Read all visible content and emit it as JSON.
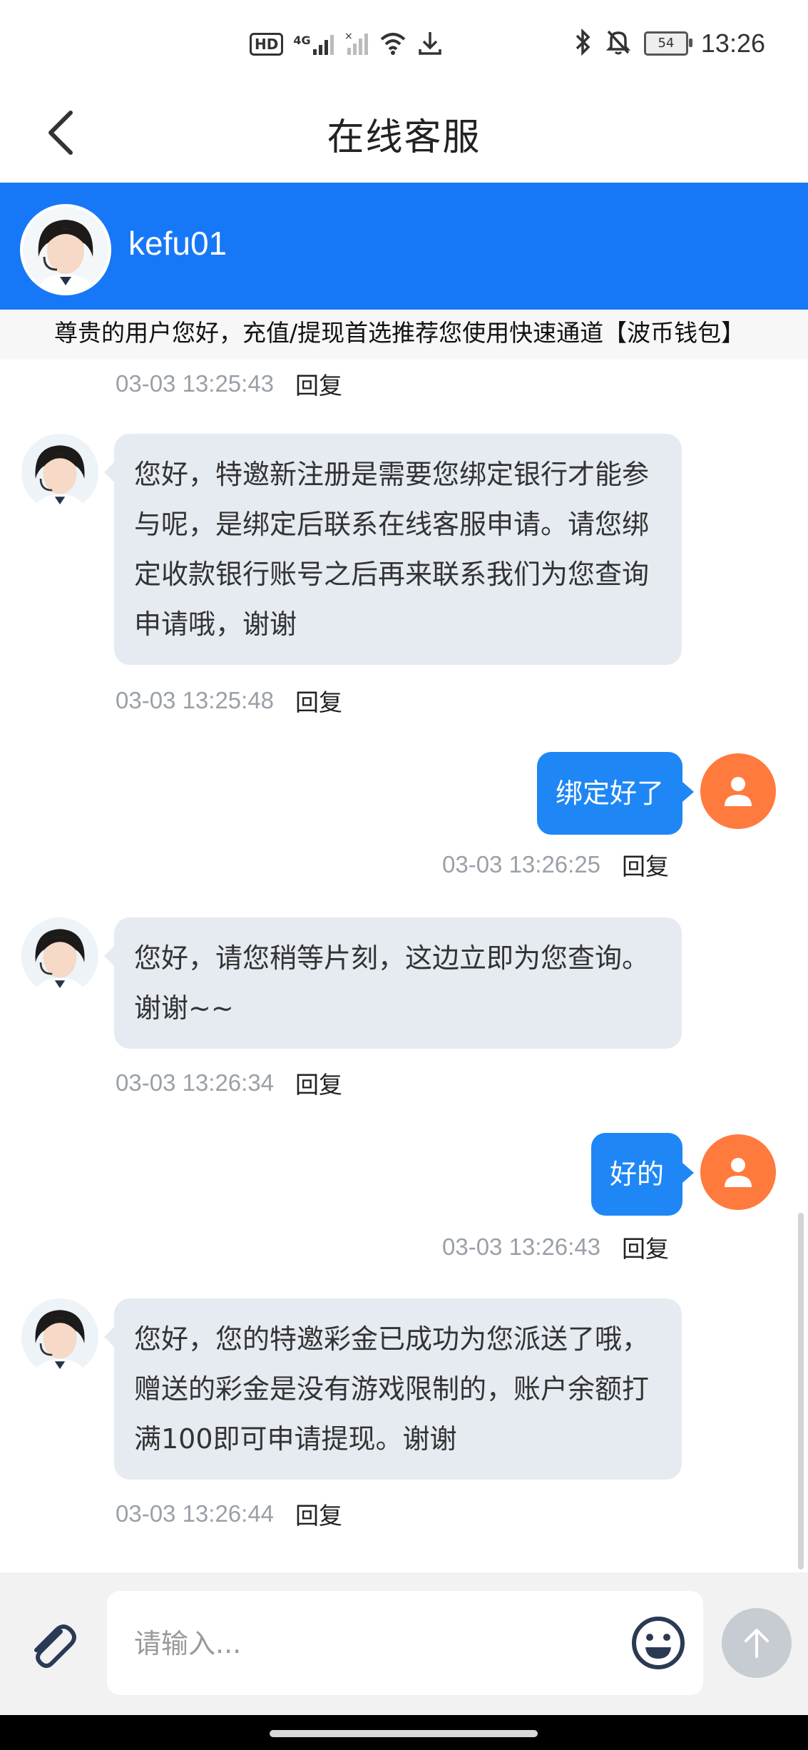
{
  "status_bar": {
    "left_icons": [
      "hd-icon",
      "signal-4g-icon",
      "signal-icon",
      "wifi-icon",
      "download-icon"
    ],
    "hd_label": "HD",
    "network_label": "4G",
    "battery_level": "54",
    "time": "13:26",
    "right_icons": [
      "bluetooth-icon",
      "mute-icon",
      "battery-icon"
    ]
  },
  "nav": {
    "title": "在线客服",
    "back_icon": "back-chevron-icon"
  },
  "agent": {
    "name": "kefu01"
  },
  "notice": {
    "text": "尊贵的用户您好，充值/提现首选推荐您使用快速通道【波币钱包】"
  },
  "messages": [
    {
      "side": "meta-only",
      "time": "03-03 13:25:43",
      "reply": "回复"
    },
    {
      "side": "left",
      "text": "您好，特邀新注册是需要您绑定银行才能参与呢，是绑定后联系在线客服申请。请您绑定收款银行账号之后再来联系我们为您查询申请哦，谢谢",
      "time": "03-03 13:25:48",
      "reply": "回复"
    },
    {
      "side": "right",
      "text": "绑定好了",
      "time": "03-03 13:26:25",
      "reply": "回复"
    },
    {
      "side": "left",
      "text": "您好，请您稍等片刻，这边立即为您查询。谢谢~~",
      "time": "03-03 13:26:34",
      "reply": "回复"
    },
    {
      "side": "right",
      "text": "好的",
      "time": "03-03 13:26:43",
      "reply": "回复"
    },
    {
      "side": "left",
      "text": "您好，您的特邀彩金已成功为您派送了哦，赠送的彩金是没有游戏限制的，账户余额打满100即可申请提现。谢谢",
      "time": "03-03 13:26:44",
      "reply": "回复"
    }
  ],
  "input": {
    "placeholder": "请输入...",
    "value": ""
  },
  "colors": {
    "primary": "#1778f7",
    "bubble_left": "#e6ebf2",
    "bubble_right": "#1e87f5",
    "user_avatar": "#ff7a3d"
  }
}
